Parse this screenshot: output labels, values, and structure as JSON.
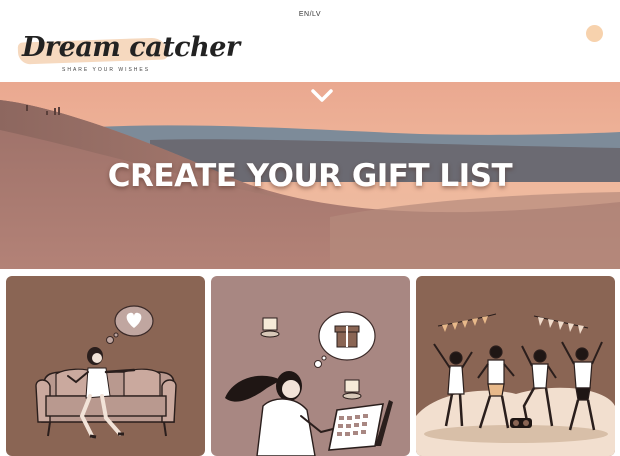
{
  "header": {
    "language_switch": "EN/LV",
    "logo_title": "Dream catcher",
    "logo_subtitle": "SHARE YOUR WISHES"
  },
  "hero": {
    "title": "CREATE YOUR GIFT LIST",
    "scroll_icon": "chevron-down-icon"
  },
  "cards": [
    {
      "illustration": "woman-on-sofa-dreaming-of-love"
    },
    {
      "illustration": "woman-ordering-gifts-on-laptop"
    },
    {
      "illustration": "friends-celebrating-party"
    }
  ],
  "colors": {
    "logo_brush": "#f6d9bf",
    "card_brown": "#8a6554",
    "card_mauve": "#a88782",
    "avatar": "#f7d2ad"
  }
}
